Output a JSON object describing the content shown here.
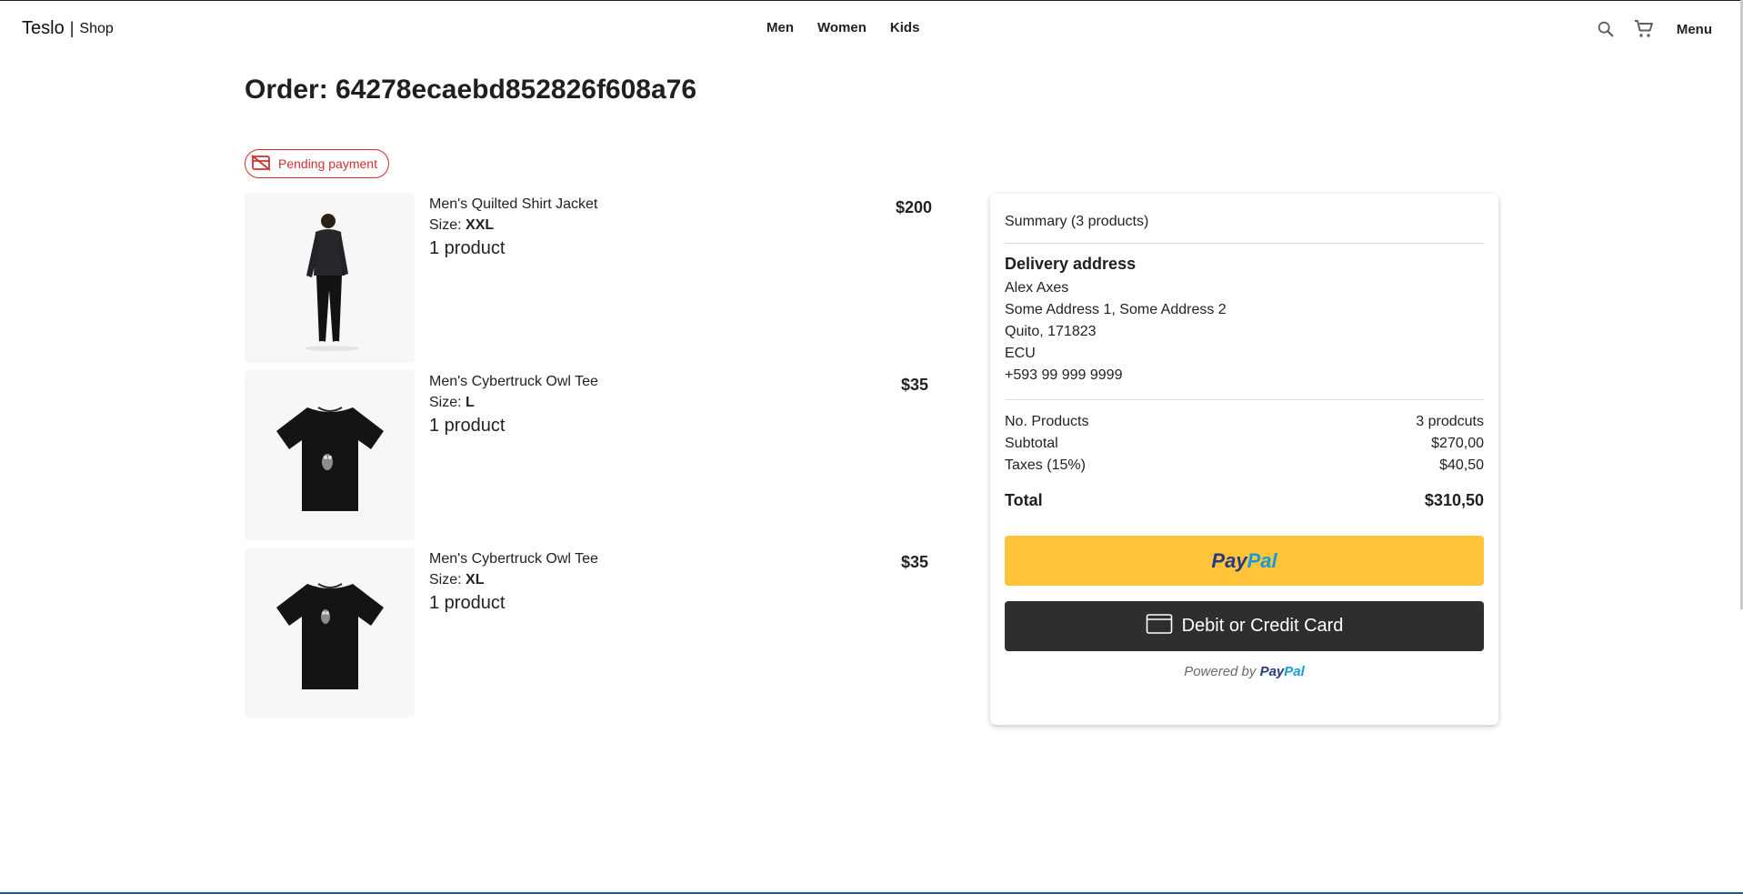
{
  "header": {
    "brand": "Teslo",
    "separator": "|",
    "brand_sub": "Shop",
    "nav": [
      "Men",
      "Women",
      "Kids"
    ],
    "search_icon": "search-icon",
    "cart_icon": "cart-icon",
    "menu_label": "Menu"
  },
  "order": {
    "title": "Order: 64278ecaebd852826f608a76",
    "status": "Pending payment",
    "status_color": "#d32f2f"
  },
  "products": [
    {
      "name": "Men's Quilted Shirt Jacket",
      "size_label": "Size:",
      "size": "XXL",
      "qty": "1 product",
      "price": "$200"
    },
    {
      "name": "Men's Cybertruck Owl Tee",
      "size_label": "Size:",
      "size": "L",
      "qty": "1 product",
      "price": "$35"
    },
    {
      "name": "Men's Cybertruck Owl Tee",
      "size_label": "Size:",
      "size": "XL",
      "qty": "1 product",
      "price": "$35"
    }
  ],
  "summary": {
    "title": "Summary (3 products)",
    "address_title": "Delivery address",
    "address_lines": [
      "Alex Axes",
      "Some Address 1, Some Address 2",
      "Quito, 171823",
      "ECU",
      "+593 99 999 9999"
    ],
    "rows": [
      {
        "label": "No. Products",
        "value": "3 prodcuts"
      },
      {
        "label": "Subtotal",
        "value": "$270,00"
      },
      {
        "label": "Taxes (15%)",
        "value": "$40,50"
      }
    ],
    "total_label": "Total",
    "total_value": "$310,50",
    "paypal_a": "Pay",
    "paypal_b": "Pal",
    "card_button": "Debit or Credit Card",
    "powered_by": "Powered by",
    "powered_brand_a": "Pay",
    "powered_brand_b": "Pal",
    "paypal_yellow": "#ffc439",
    "card_button_color": "#2c2e2f"
  }
}
